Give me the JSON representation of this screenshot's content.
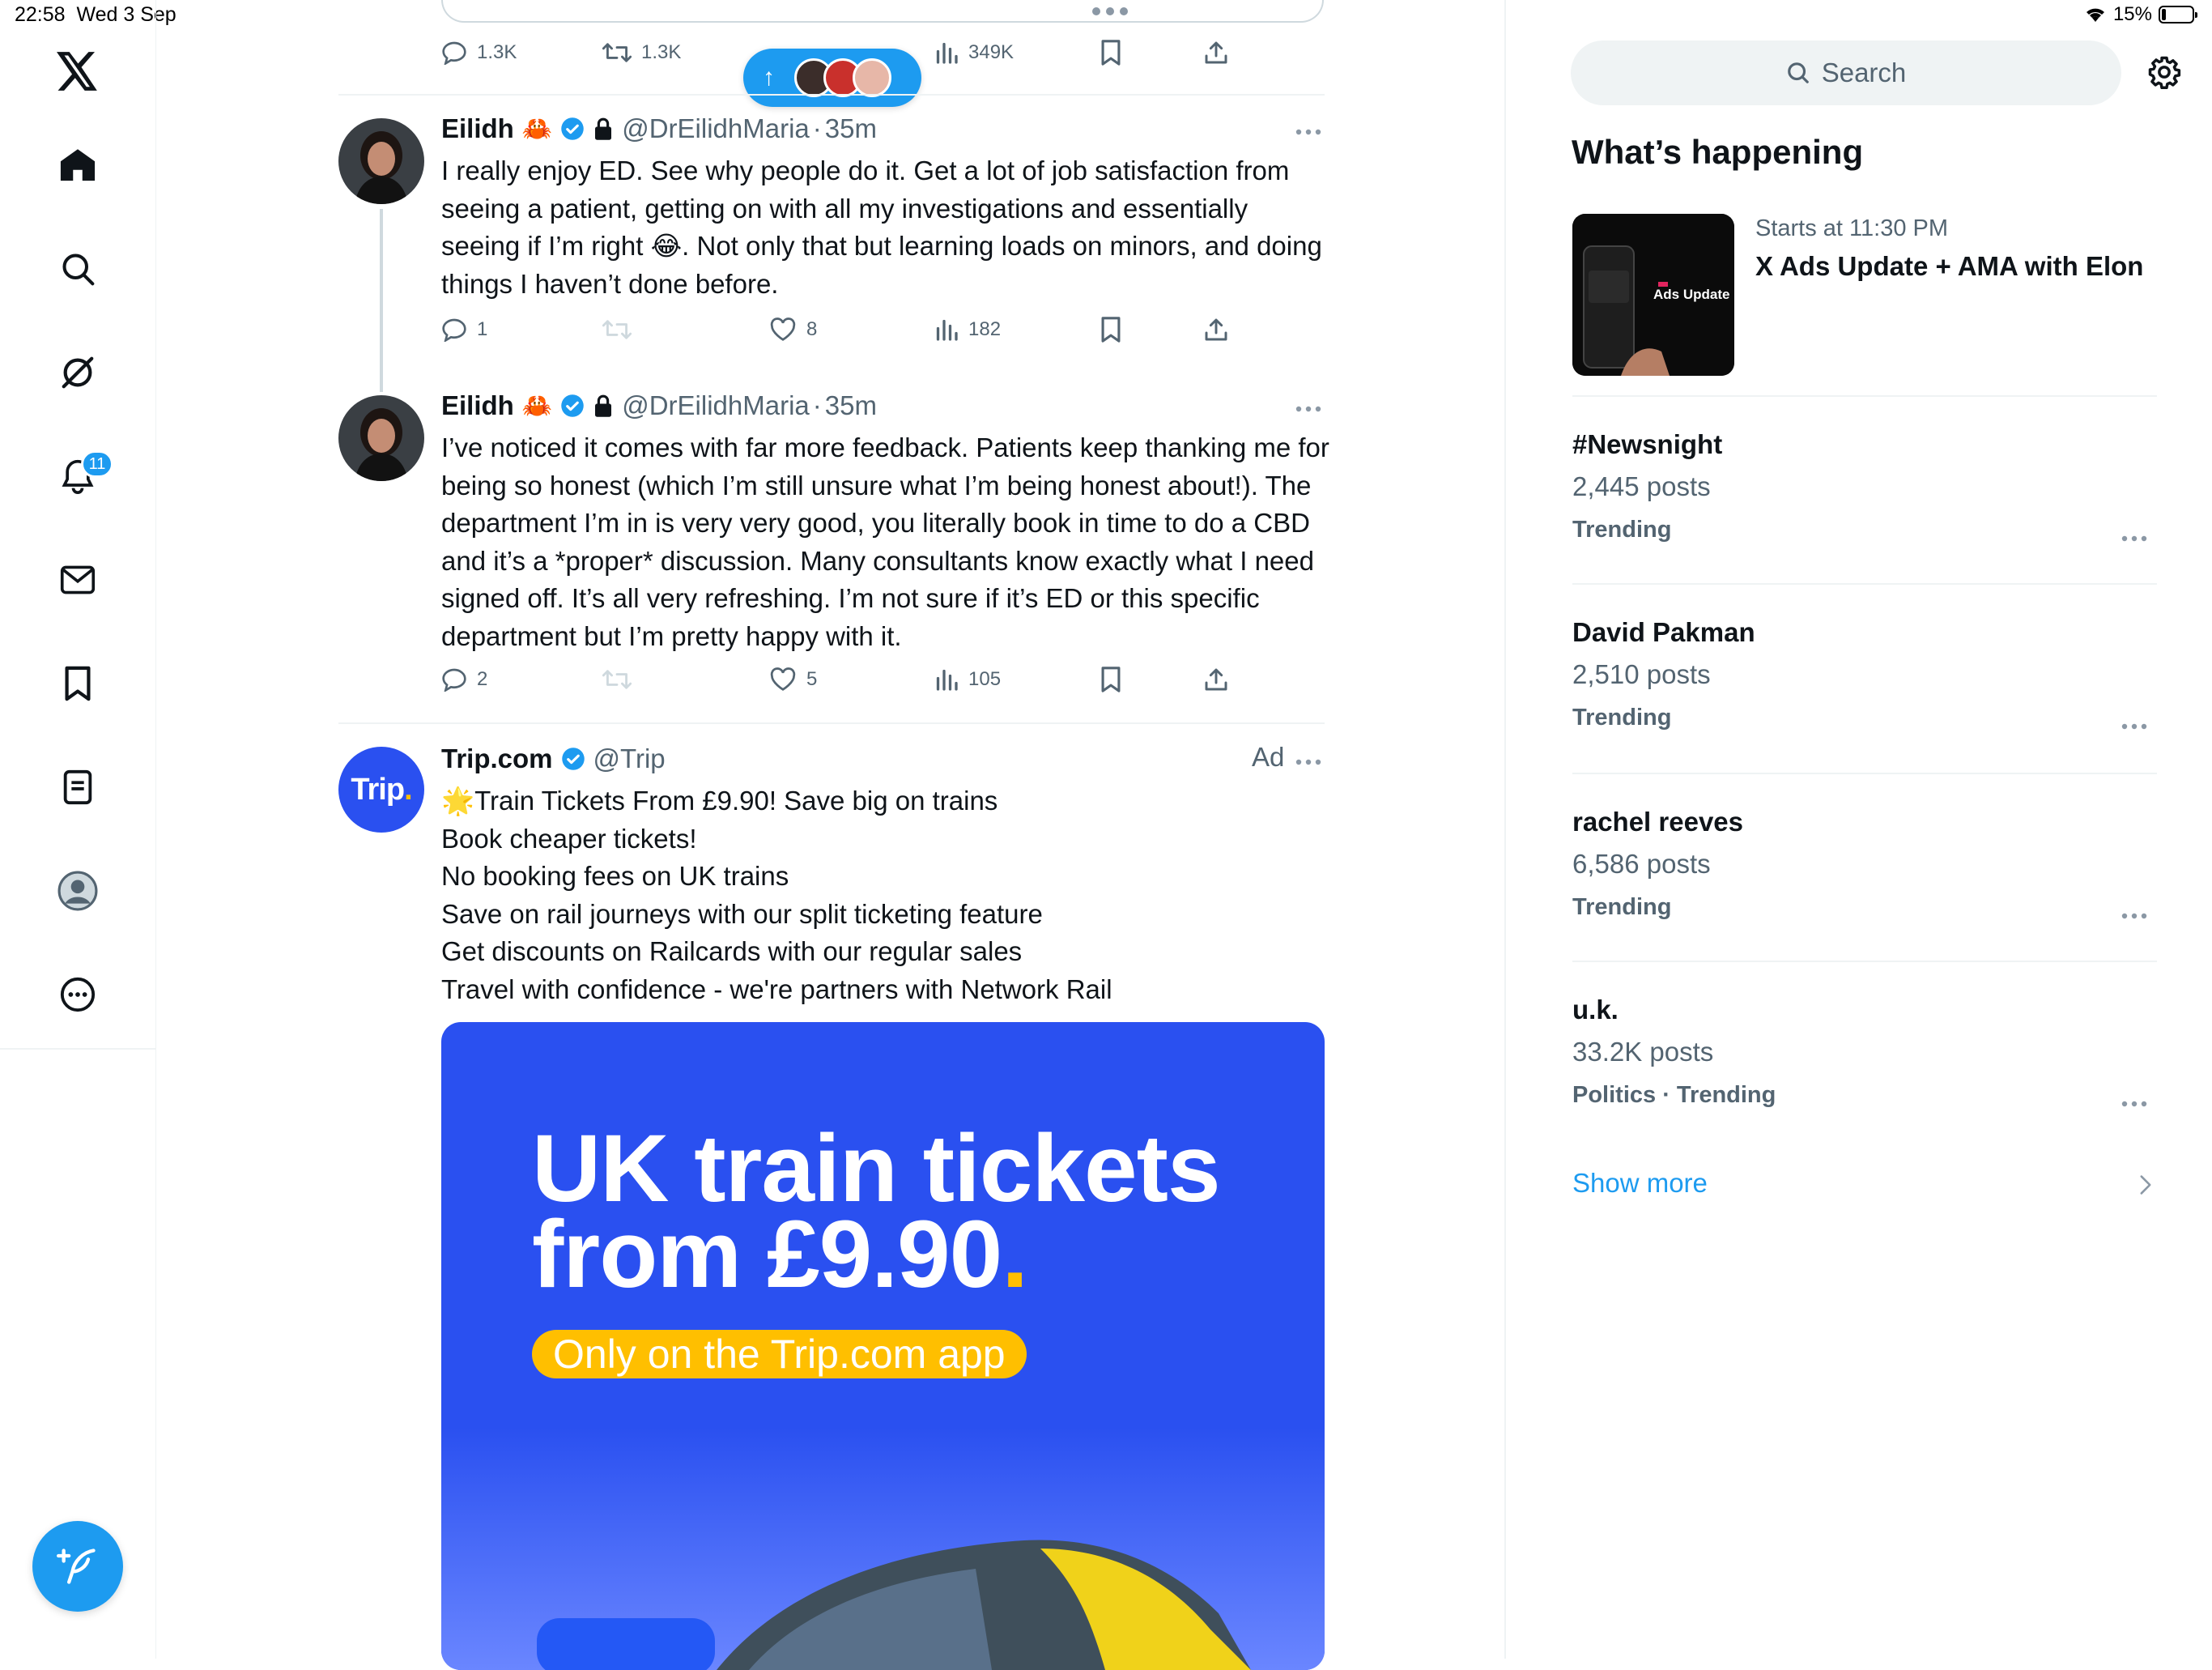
{
  "status_bar": {
    "time": "22:58",
    "date": "Wed 3 Sep",
    "battery": "15%"
  },
  "nav": {
    "notifications_badge": "11"
  },
  "prev_tweet": {
    "replies": "1.3K",
    "reposts": "1.3K",
    "views": "349K"
  },
  "new_posts_pill": {
    "arrow": "↑"
  },
  "tweets": [
    {
      "name": "Eilidh",
      "emoji": "🦀",
      "handle": "@DrEilidhMaria",
      "sep": "·",
      "time": "35m",
      "text": "I really enjoy ED. See why people do it. Get a lot of job satisfaction from seeing a patient, getting on with all my investigations and essentially seeing if I’m right 😂. Not only that but learning loads on minors, and doing things I haven’t done before.",
      "replies": "1",
      "likes": "8",
      "views": "182"
    },
    {
      "name": "Eilidh",
      "emoji": "🦀",
      "handle": "@DrEilidhMaria",
      "sep": "·",
      "time": "35m",
      "text": "I’ve noticed it comes with far more feedback. Patients keep thanking me for being so honest (which I’m still unsure what I’m being honest about!). The department I’m in is very very good, you literally book in time to do a CBD and it’s a *proper* discussion. Many consultants know exactly what I need signed off. It’s all very refreshing. I’m not sure if it’s ED or this specific department but I’m pretty happy with it.",
      "replies": "2",
      "likes": "5",
      "views": "105"
    }
  ],
  "ad": {
    "avatar_text": "Trip",
    "avatar_dot": ".",
    "name": "Trip.com",
    "handle": "@Trip",
    "label": "Ad",
    "lines": [
      "🌟Train Tickets From £9.90! Save big on trains",
      "Book cheaper tickets!",
      "No booking fees on UK trains",
      "Save on rail journeys with our split ticketing feature",
      "Get discounts on Railcards with our regular sales",
      "Travel with confidence - we're partners with Network Rail"
    ],
    "promo_line1": "UK train tickets",
    "promo_line2": "from £9.90",
    "promo_dot": ".",
    "promo_tag": "Only on the Trip.com app"
  },
  "right": {
    "search_placeholder": "Search",
    "section_title": "What’s happening",
    "event": {
      "meta": "Starts at 11:30 PM",
      "title": "X Ads Update + AMA with Elon",
      "image_text": "Ads Update"
    },
    "trends": [
      {
        "name": "#Newsnight",
        "count": "2,445 posts",
        "category": "Trending"
      },
      {
        "name": "David Pakman",
        "count": "2,510 posts",
        "category": "Trending"
      },
      {
        "name": "rachel reeves",
        "count": "6,586 posts",
        "category": "Trending"
      },
      {
        "name": "u.k.",
        "count": "33.2K posts",
        "category": "Politics · Trending"
      }
    ],
    "show_more": "Show more"
  },
  "colors": {
    "accent": "#1d9bf0",
    "text": "#0f1419",
    "muted": "#536471",
    "divider": "#eff3f4",
    "promo_bg": "#2a50f0",
    "promo_yellow": "#ffbf00"
  }
}
